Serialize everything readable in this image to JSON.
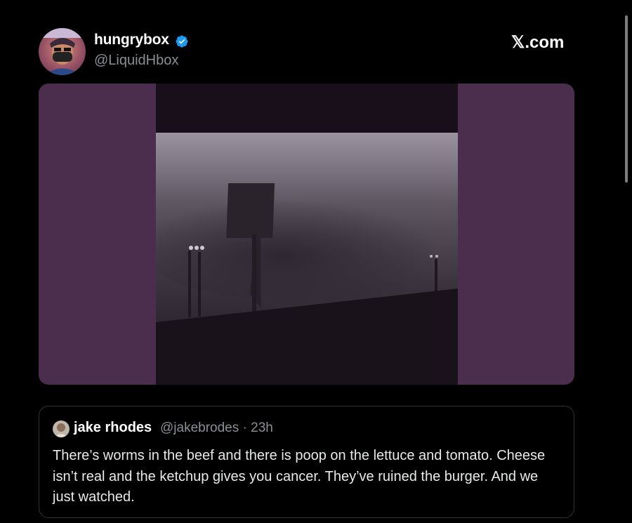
{
  "tweet": {
    "display_name": "hungrybox",
    "handle": "@LiquidHbox",
    "verified": true,
    "site": "𝕏.com"
  },
  "media": {
    "type": "video-thumbnail",
    "letterbox_color": "#4b2d4d"
  },
  "quote": {
    "name": "jake rhodes",
    "handle_time": "@jakebrodes · 23h",
    "text": "There’s worms in the beef and there is poop on the lettuce and tomato. Cheese isn’t real and the ketchup gives you cancer. They’ve ruined the burger. And we just watched."
  },
  "colors": {
    "background": "#000000",
    "verified": "#1d9bf0",
    "secondary_text": "#8b8f94"
  }
}
